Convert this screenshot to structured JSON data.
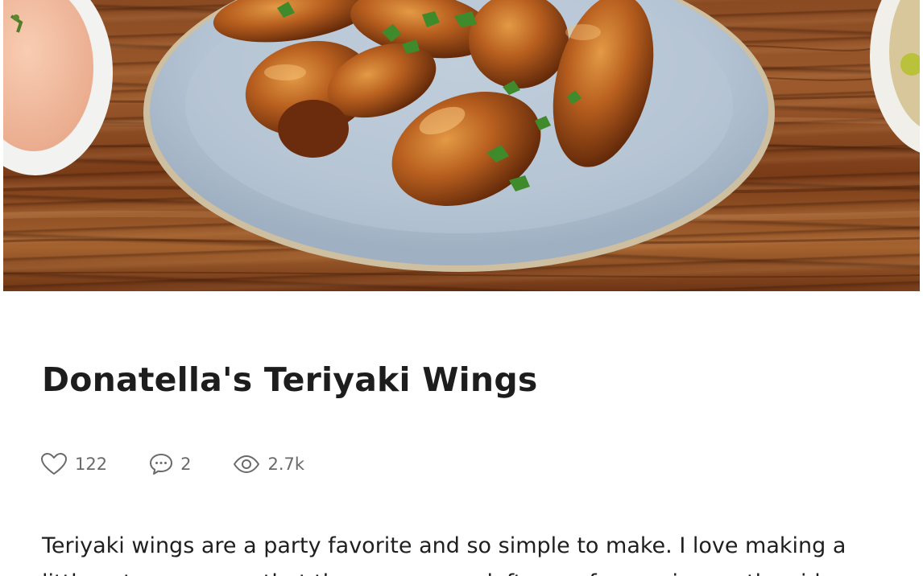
{
  "recipe": {
    "title": "Donatella's Teriyaki Wings",
    "description": "Teriyaki wings are a party favorite and so simple to make. I love making a little extra sauce so that there are some leftovers for serving on the side."
  },
  "stats": {
    "likes": "122",
    "comments": "2",
    "views": "2.7k"
  },
  "icons": {
    "likes": "heart-icon",
    "comments": "comment-bubble-icon",
    "views": "eye-icon"
  },
  "colors": {
    "title": "#1d1d1d",
    "stats_text": "#6a6a6a",
    "body_text": "#1f1f1f",
    "plate": "#b9c7d6",
    "wood": "#8a4a22"
  }
}
